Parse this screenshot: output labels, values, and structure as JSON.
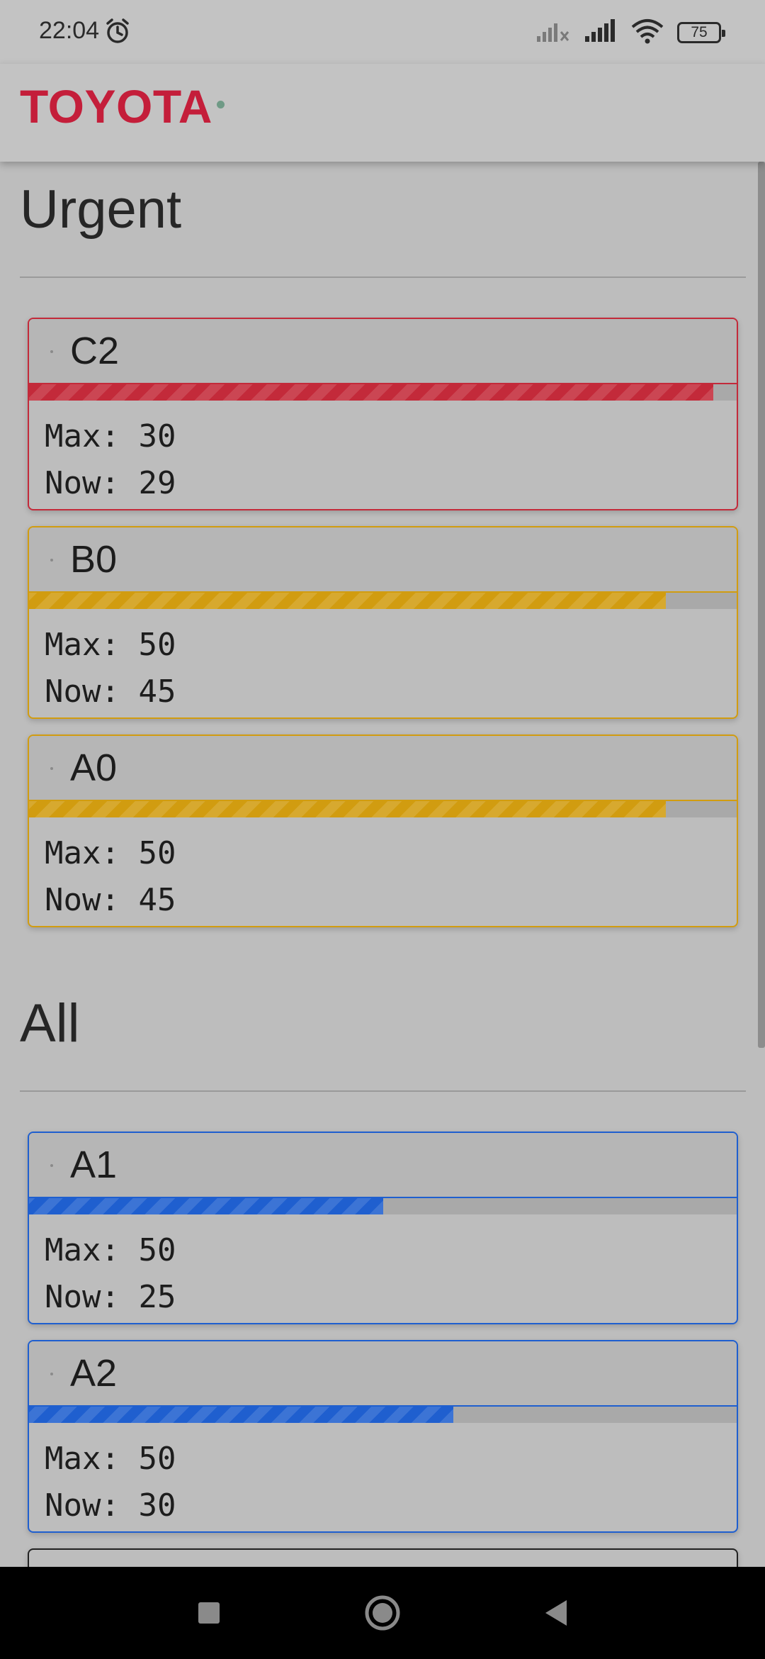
{
  "status": {
    "time": "22:04",
    "battery": "75"
  },
  "header": {
    "brand": "TOYOTA"
  },
  "sections": {
    "urgent_title": "Urgent",
    "all_title": "All"
  },
  "colors": {
    "red": "#c32a3a",
    "amber": "#d19c10",
    "blue": "#1f5fcf"
  },
  "urgent_cards": [
    {
      "name": "C2",
      "max_line": "Max: 30",
      "now_line": "Now: 29",
      "max": 30,
      "now": 29,
      "color": "red"
    },
    {
      "name": "B0",
      "max_line": "Max: 50",
      "now_line": "Now: 45",
      "max": 50,
      "now": 45,
      "color": "amber"
    },
    {
      "name": "A0",
      "max_line": "Max: 50",
      "now_line": "Now: 45",
      "max": 50,
      "now": 45,
      "color": "amber"
    }
  ],
  "all_cards": [
    {
      "name": "A1",
      "max_line": "Max: 50",
      "now_line": "Now: 25",
      "max": 50,
      "now": 25,
      "color": "blue"
    },
    {
      "name": "A2",
      "max_line": "Max: 50",
      "now_line": "Now: 30",
      "max": 50,
      "now": 30,
      "color": "blue"
    }
  ]
}
